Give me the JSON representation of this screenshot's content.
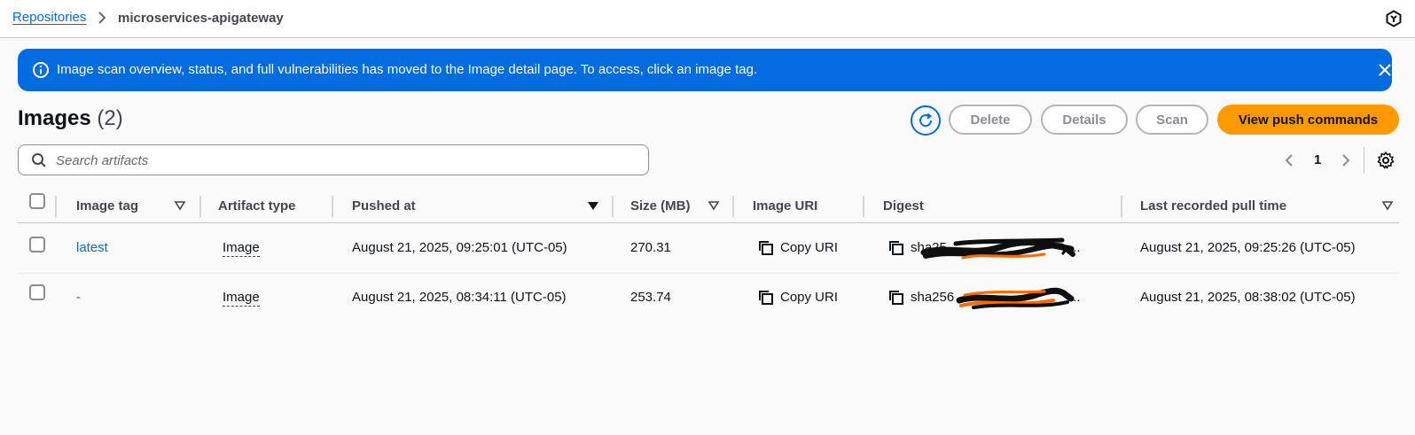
{
  "breadcrumb": {
    "parent": "Repositories",
    "current": "microservices-apigateway"
  },
  "flash": {
    "message": "Image scan overview, status, and full vulnerabilities has moved to the Image detail page. To access, click an image tag."
  },
  "header": {
    "title": "Images",
    "count": "(2)"
  },
  "actions": {
    "delete": "Delete",
    "details": "Details",
    "scan": "Scan",
    "push": "View push commands"
  },
  "search": {
    "placeholder": "Search artifacts",
    "value": ""
  },
  "pagination": {
    "page": "1"
  },
  "table": {
    "columns": {
      "tag": "Image tag",
      "type": "Artifact type",
      "pushed": "Pushed at",
      "size": "Size (MB)",
      "uri": "Image URI",
      "digest": "Digest",
      "pull": "Last recorded pull time"
    },
    "rows": [
      {
        "tag": "latest",
        "type": "Image",
        "pushed": "August 21, 2025, 09:25:01 (UTC-05)",
        "size": "270.31",
        "uri": "Copy URI",
        "digest": "sha25",
        "digest_tail": "...",
        "pull": "August 21, 2025, 09:25:26 (UTC-05)"
      },
      {
        "tag": "-",
        "type": "Image",
        "pushed": "August 21, 2025, 08:34:11 (UTC-05)",
        "size": "253.74",
        "uri": "Copy URI",
        "digest": "sha256",
        "digest_tail": "...",
        "pull": "August 21, 2025, 08:38:02 (UTC-05)"
      }
    ]
  },
  "colors": {
    "primary": "#006ce0",
    "accent": "#ff9900",
    "text": "#0f141a",
    "muted": "#424650"
  }
}
